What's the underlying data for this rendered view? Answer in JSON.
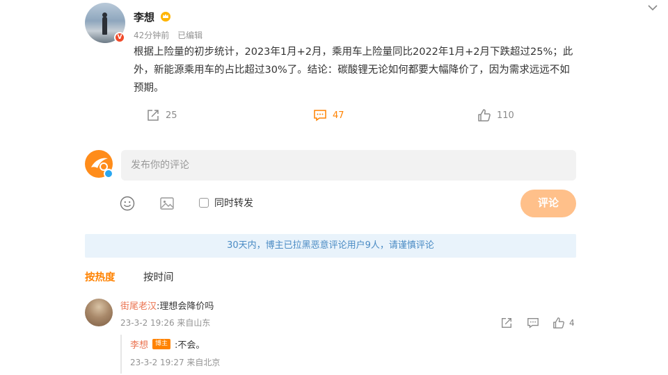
{
  "post": {
    "username": "李想",
    "time": "42分钟前",
    "edited": "已编辑",
    "text": "根据上险量的初步统计，2023年1月+2月，乘用车上险量同比2022年1月+2月下跌超过25%；此外，新能源乘用车的占比超过30%了。结论：碳酸锂无论如何都要大幅降价了，因为需求远远不如预期。",
    "repost_count": "25",
    "comment_count": "47",
    "like_count": "110",
    "verified_badge_icon": "verified-v-icon",
    "crown_icon": "crown-icon"
  },
  "composer": {
    "placeholder": "发布你的评论",
    "forward_label": "同时转发",
    "submit_label": "评论"
  },
  "notice": "30天内，博主已拉黑恶意评论用户9人，请谨慎评论",
  "sort": {
    "hot_label": "按热度",
    "time_label": "按时间"
  },
  "comment": {
    "username": "街尾老汉",
    "separator": ":",
    "text": "理想会降价吗",
    "meta": "23-3-2 19:26 来自山东",
    "like_count": "4",
    "reply": {
      "username": "李想",
      "badge": "博主",
      "text": ":不会。",
      "meta": "23-3-2 19:27 来自北京"
    }
  },
  "colors": {
    "accent": "#ff8200",
    "username_link": "#eb7350",
    "notice_bg": "#e9f3fb",
    "notice_text": "#4a8bc4",
    "submit_disabled": "#ffc08a"
  }
}
